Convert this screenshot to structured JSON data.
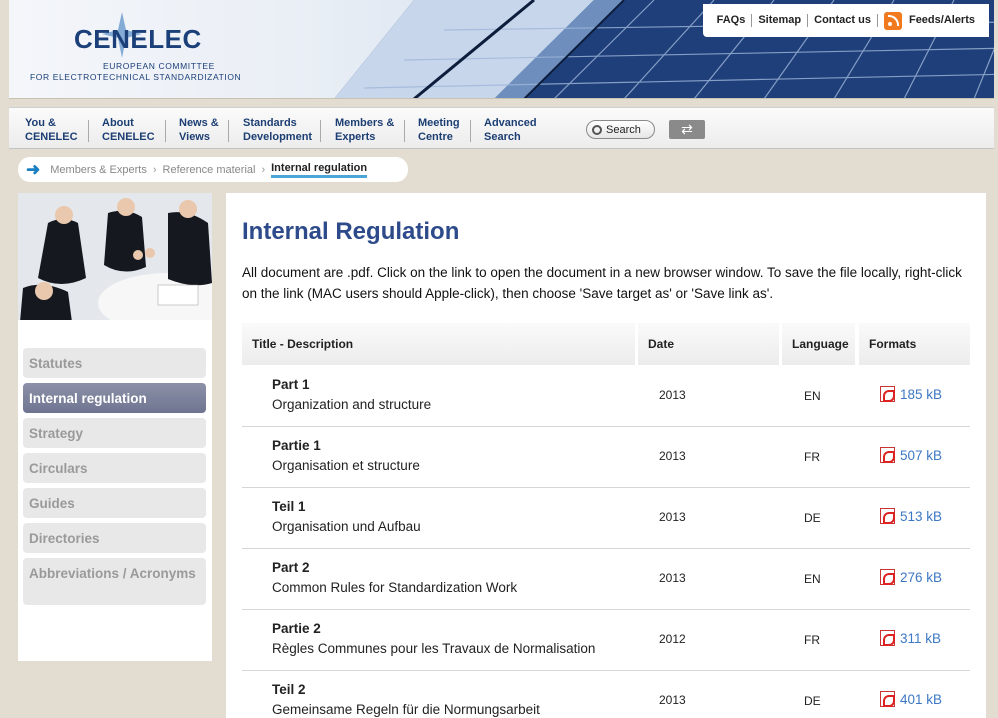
{
  "header": {
    "logo": {
      "word": "CENELEC",
      "line1": "EUROPEAN COMMITTEE",
      "line2": "FOR ELECTROTECHNICAL STANDARDIZATION"
    },
    "toplinks": [
      "FAQs",
      "Sitemap",
      "Contact us",
      "Feeds/Alerts"
    ]
  },
  "nav": {
    "items": [
      {
        "line1": "You &",
        "line2": "CENELEC"
      },
      {
        "line1": "About",
        "line2": "CENELEC"
      },
      {
        "line1": "News &",
        "line2": "Views"
      },
      {
        "line1": "Standards",
        "line2": "Development"
      },
      {
        "line1": "Members &",
        "line2": "Experts"
      },
      {
        "line1": "Meeting",
        "line2": "Centre"
      },
      {
        "line1": "Advanced",
        "line2": "Search"
      }
    ],
    "search_label": "Search"
  },
  "breadcrumb": [
    "Members & Experts",
    "Reference material",
    "Internal regulation"
  ],
  "sidebar": {
    "items": [
      "Statutes",
      "Internal regulation",
      "Strategy",
      "Circulars",
      "Guides",
      "Directories",
      "Abbreviations / Acronyms"
    ],
    "active": "Internal regulation"
  },
  "main": {
    "title": "Internal Regulation",
    "intro": "All document are .pdf. Click on the link to open the document in a new browser window. To save the file locally, right-click on the link (MAC users should Apple-click), then choose 'Save target as' or 'Save link as'.",
    "columns": [
      "Title - Description",
      "Date",
      "Language",
      "Formats"
    ],
    "rows": [
      {
        "title": "Part 1",
        "desc": "Organization and structure",
        "date": "2013",
        "lang": "EN",
        "size": "185 kB"
      },
      {
        "title": "Partie 1",
        "desc": "Organisation et structure",
        "date": "2013",
        "lang": "FR",
        "size": "507 kB"
      },
      {
        "title": "Teil 1",
        "desc": "Organisation und Aufbau",
        "date": "2013",
        "lang": "DE",
        "size": "513 kB"
      },
      {
        "title": "Part 2",
        "desc": "Common Rules for Standardization Work",
        "date": "2013",
        "lang": "EN",
        "size": "276 kB"
      },
      {
        "title": "Partie 2",
        "desc": "Règles Communes pour les Travaux de Normalisation",
        "date": "2012",
        "lang": "FR",
        "size": "311 kB"
      },
      {
        "title": "Teil 2",
        "desc": "Gemeinsame Regeln für die Normungsarbeit",
        "date": "2013",
        "lang": "DE",
        "size": "401 kB"
      }
    ]
  }
}
